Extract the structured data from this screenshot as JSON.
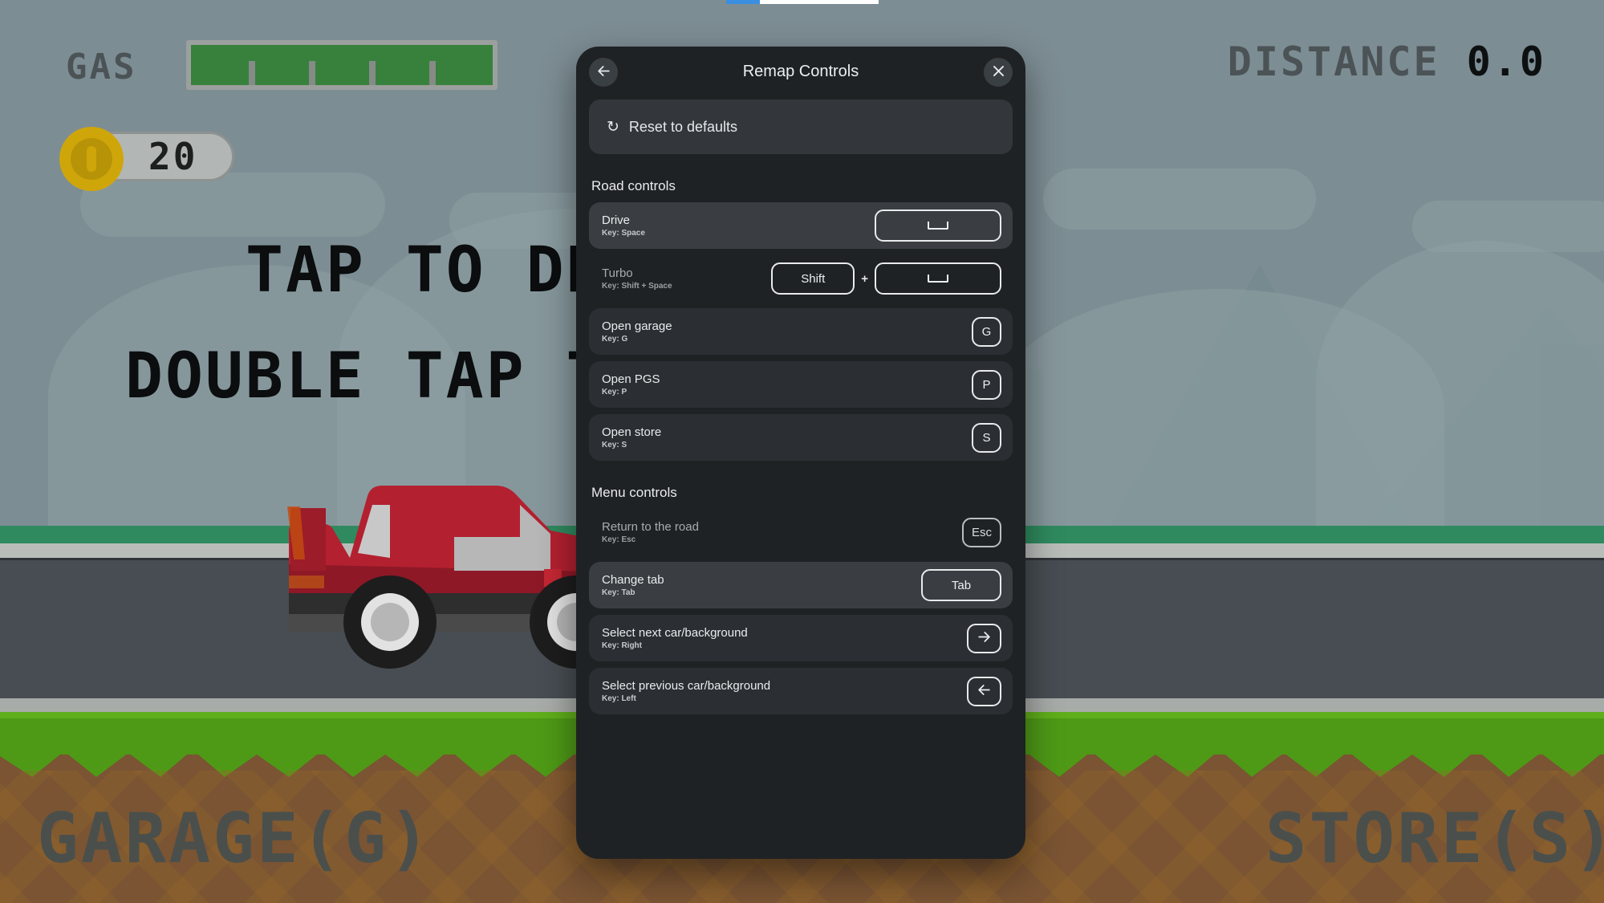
{
  "game": {
    "gas_label": "GAS",
    "gas_fill_percent": 100,
    "coin_count": "20",
    "distance_label": "DISTANCE",
    "distance_value": "0.0",
    "tap_line_1": "TAP TO DRIVE",
    "tap_line_2": "DOUBLE TAP TO TURBO",
    "garage_label": "GARAGE(G)",
    "store_label": "STORE(S)",
    "colors": {
      "sky": "#7d8d94",
      "road": "#474d52",
      "grass": "#4e9a16",
      "dirt": "#7a5433",
      "gas_fill": "#37813d",
      "coin": "#cfa60a",
      "car_body": "#b32030"
    }
  },
  "top_progress": {
    "percent": 22,
    "fill_color": "#3b8fe0"
  },
  "modal": {
    "title": "Remap Controls",
    "back_icon": "arrow-left-icon",
    "close_icon": "close-icon",
    "reset": {
      "icon": "reset-icon",
      "label": "Reset to defaults"
    },
    "sections": [
      {
        "title": "Road controls",
        "rows": [
          {
            "name": "Drive",
            "key_text": "Key: Space",
            "state": "hover",
            "keys": [
              {
                "type": "space",
                "label": ""
              }
            ]
          },
          {
            "name": "Turbo",
            "key_text": "Key: Shift + Space",
            "state": "plain",
            "keys": [
              {
                "type": "shift",
                "label": "Shift"
              },
              {
                "type": "plus",
                "label": "+"
              },
              {
                "type": "space",
                "label": ""
              }
            ]
          },
          {
            "name": "Open garage",
            "key_text": "Key: G",
            "state": "normal",
            "keys": [
              {
                "type": "letter",
                "label": "G"
              }
            ]
          },
          {
            "name": "Open PGS",
            "key_text": "Key: P",
            "state": "normal",
            "keys": [
              {
                "type": "letter",
                "label": "P"
              }
            ]
          },
          {
            "name": "Open store",
            "key_text": "Key: S",
            "state": "normal",
            "keys": [
              {
                "type": "letter",
                "label": "S"
              }
            ]
          }
        ]
      },
      {
        "title": "Menu controls",
        "rows": [
          {
            "name": "Return to the road",
            "key_text": "Key: Esc",
            "state": "plain",
            "keys": [
              {
                "type": "word",
                "label": "Esc"
              }
            ]
          },
          {
            "name": "Change tab",
            "key_text": "Key: Tab",
            "state": "hover",
            "keys": [
              {
                "type": "tab",
                "label": "Tab"
              }
            ]
          },
          {
            "name": "Select next car/background",
            "key_text": "Key: Right",
            "state": "normal",
            "keys": [
              {
                "type": "arrow-right",
                "label": ""
              }
            ]
          },
          {
            "name": "Select previous car/background",
            "key_text": "Key: Left",
            "state": "normal",
            "keys": [
              {
                "type": "arrow-left",
                "label": ""
              }
            ]
          }
        ]
      }
    ]
  }
}
